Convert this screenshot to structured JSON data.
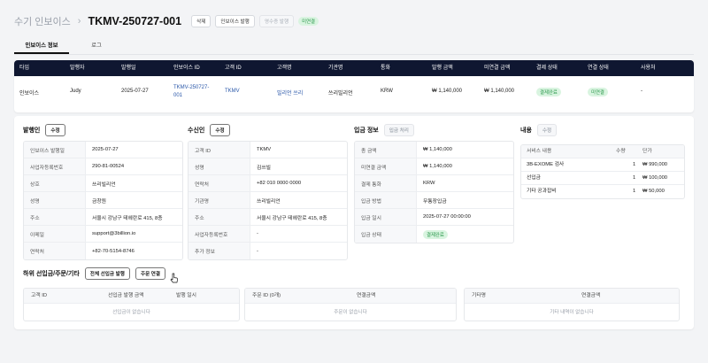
{
  "header": {
    "breadcrumb": "수기 인보이스",
    "title": "TKMV-250727-001",
    "delete_label": "삭제",
    "issue_invoice_label": "인보이스 발행",
    "issue_receipt_label": "영수증 발행",
    "status_badge": "미연결"
  },
  "tabs": [
    {
      "label": "인보이스 정보",
      "active": true
    },
    {
      "label": "로그",
      "active": false
    }
  ],
  "summary_table": {
    "headers": [
      "타입",
      "발행자",
      "발행일",
      "인보이스 ID",
      "고객 ID",
      "고객명",
      "기관명",
      "통화",
      "발행 금액",
      "미연결 금액",
      "결제 상태",
      "연결 상태",
      "사용처"
    ],
    "row": {
      "type": "인보이스",
      "issuer": "Judy",
      "issue_date": "2025-07-27",
      "invoice_id_line1": "TKMV-250727-",
      "invoice_id_line2": "001",
      "customer_id": "TKMV",
      "customer_name": "빌리언 쓰리",
      "org_name": "쓰리빌리언",
      "currency": "KRW",
      "issued_amount": "₩ 1,140,000",
      "unlinked_amount": "₩ 1,140,000",
      "payment_status": "결제완료",
      "link_status": "미연결",
      "usage": "-"
    }
  },
  "issuer": {
    "title": "발행인",
    "edit_label": "수정",
    "rows": [
      {
        "key": "인보이스 발행일",
        "value": "2025-07-27"
      },
      {
        "key": "사업자등록번호",
        "value": "290-81-00524"
      },
      {
        "key": "상호",
        "value": "쓰리빌리언"
      },
      {
        "key": "성명",
        "value": "금창원"
      },
      {
        "key": "주소",
        "value": "서울시 강남구 테헤란로 415, 8층"
      },
      {
        "key": "이메일",
        "value": "support@3billion.io"
      },
      {
        "key": "연락처",
        "value": "+82-70-5154-8746"
      }
    ]
  },
  "recipient": {
    "title": "수신인",
    "edit_label": "수정",
    "rows": [
      {
        "key": "고객 ID",
        "value": "TKMV",
        "link": true
      },
      {
        "key": "성명",
        "value": "김쓰빌"
      },
      {
        "key": "연락처",
        "value": "+82 010 0000 0000"
      },
      {
        "key": "기관명",
        "value": "쓰리빌리언"
      },
      {
        "key": "주소",
        "value": "서울시 강남구 테헤란로 415, 8층"
      },
      {
        "key": "사업자등록번호",
        "value": "-"
      },
      {
        "key": "추가 정보",
        "value": "-"
      }
    ]
  },
  "payment": {
    "title": "입금 정보",
    "process_label": "입금 처리",
    "rows": [
      {
        "key": "총 금액",
        "value": "₩ 1,140,000"
      },
      {
        "key": "미연결 금액",
        "value": "₩ 1,140,000"
      },
      {
        "key": "결제 통화",
        "value": "KRW"
      },
      {
        "key": "입금 방법",
        "value": "무통장입금"
      },
      {
        "key": "입금 일시",
        "value": "2025-07-27 00:00:00"
      },
      {
        "key": "입금 상태",
        "value": "결제완료",
        "badge": true
      }
    ]
  },
  "contents": {
    "title": "내용",
    "edit_label": "수정",
    "headers": [
      "서비스 내용",
      "수량",
      "단가"
    ],
    "rows": [
      {
        "service": "3B-EXOME 검사",
        "qty": "1",
        "price": "₩ 990,000"
      },
      {
        "service": "선입금",
        "qty": "1",
        "price": "₩ 100,000"
      },
      {
        "service": "기타 공과잡비",
        "qty": "1",
        "price": "₩ 50,000"
      }
    ]
  },
  "sub_section": {
    "title": "하위 선입금/주문/기타",
    "issue_all_label": "전체 선입금 발행",
    "link_order_label": "주문 연결",
    "prepay_table": {
      "headers": [
        "고객 ID",
        "선입금 발행 금액",
        "발행 일시"
      ],
      "empty": "선입금이 없습니다"
    },
    "order_table": {
      "headers": [
        "주문 ID (0개)",
        "연결금액"
      ],
      "empty": "주문이 없습니다"
    },
    "other_table": {
      "headers": [
        "기타명",
        "연결금액"
      ],
      "empty": "기타 내역이 없습니다"
    }
  },
  "icons": {
    "chevron": "chevron-right-icon",
    "cursor": "pointer-cursor-icon"
  },
  "colors": {
    "header_bg": "#0f1731",
    "link": "#2856a8",
    "badge_bg": "#d9f4e0",
    "badge_text": "#2f9a4f"
  }
}
